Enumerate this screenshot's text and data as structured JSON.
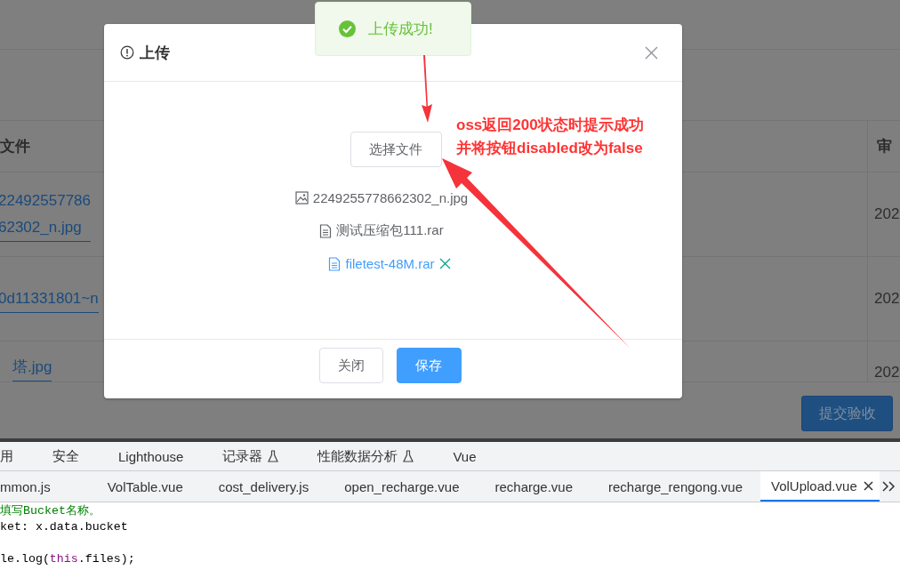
{
  "background": {
    "table": {
      "columns": [
        "文件",
        "审"
      ],
      "rows": [
        {
          "file_lines": [
            "22492557786",
            "62302_n.jpg"
          ],
          "date": "202"
        },
        {
          "file_lines": [
            "0d11331801~n"
          ],
          "date": "202"
        },
        {
          "file_lines": [
            "塔.jpg"
          ],
          "date": "202"
        }
      ]
    },
    "submit_button": "提交验收"
  },
  "dialog": {
    "title": "上传",
    "choose_button": "选择文件",
    "files": [
      {
        "kind": "image",
        "name": "2249255778662302_n.jpg",
        "hovered": false
      },
      {
        "kind": "document",
        "name": "测试压缩包111.rar",
        "hovered": false
      },
      {
        "kind": "document",
        "name": "filetest-48M.rar",
        "hovered": true
      }
    ],
    "buttons": [
      {
        "label": "关闭",
        "kind": "default"
      },
      {
        "label": "保存",
        "kind": "primary"
      }
    ]
  },
  "toast": {
    "kind": "success",
    "message": "上传成功!"
  },
  "annotation": {
    "lines": [
      "oss返回200状态时提示成功",
      "并将按钮disabled改为false"
    ]
  },
  "devtools": {
    "panel_tabs": [
      {
        "label": "用",
        "experimental": false
      },
      {
        "label": "安全",
        "experimental": false
      },
      {
        "label": "Lighthouse",
        "experimental": false
      },
      {
        "label": "记录器",
        "experimental": true
      },
      {
        "label": "性能数据分析",
        "experimental": true
      },
      {
        "label": "Vue",
        "experimental": false
      }
    ],
    "file_tabs": [
      {
        "label": "mmon.js",
        "selected": false
      },
      {
        "label": "VolTable.vue",
        "selected": false
      },
      {
        "label": "cost_delivery.js",
        "selected": false
      },
      {
        "label": "open_recharge.vue",
        "selected": false
      },
      {
        "label": "recharge.vue",
        "selected": false
      },
      {
        "label": "recharge_rengong.vue",
        "selected": false
      },
      {
        "label": "VolUpload.vue",
        "selected": true
      }
    ],
    "code_lines": [
      {
        "kind": "code",
        "tokens": [
          {
            "kind": "comment",
            "text": "填写Bucket名称。"
          }
        ]
      },
      {
        "kind": "code",
        "tokens": [
          {
            "kind": "plain",
            "text": "ket: x.data.bucket"
          }
        ]
      },
      {
        "kind": "blank"
      },
      {
        "kind": "code",
        "tokens": [
          {
            "kind": "plain",
            "text": "le.log("
          },
          {
            "kind": "keyword",
            "text": "this"
          },
          {
            "kind": "plain",
            "text": ".files);"
          }
        ]
      }
    ]
  }
}
